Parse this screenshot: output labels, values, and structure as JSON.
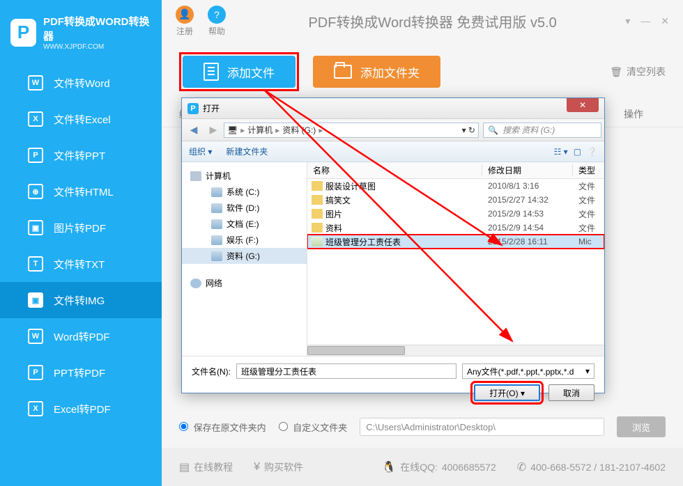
{
  "logo": {
    "letter": "P",
    "title": "PDF转换成WORD转换器",
    "sub": "WWW.XJPDF.COM"
  },
  "sidebar": {
    "items": [
      {
        "icon": "W",
        "label": "文件转Word"
      },
      {
        "icon": "X",
        "label": "文件转Excel"
      },
      {
        "icon": "P",
        "label": "文件转PPT"
      },
      {
        "icon": "⊕",
        "label": "文件转HTML"
      },
      {
        "icon": "▣",
        "label": "图片转PDF"
      },
      {
        "icon": "T",
        "label": "文件转TXT"
      },
      {
        "icon": "▣",
        "label": "文件转IMG"
      },
      {
        "icon": "W",
        "label": "Word转PDF"
      },
      {
        "icon": "P",
        "label": "PPT转PDF"
      },
      {
        "icon": "X",
        "label": "Excel转PDF"
      }
    ]
  },
  "topbar": {
    "register": "注册",
    "help": "帮助",
    "title": "PDF转换成Word转换器 免费试用版 v5.0"
  },
  "actions": {
    "add_file": "添加文件",
    "add_folder": "添加文件夹",
    "clear_list": "清空列表"
  },
  "table": {
    "col_name": "编",
    "col_ops": "操作"
  },
  "dialog": {
    "title": "打开",
    "path_parts": [
      "计算机",
      "资料 (G:)"
    ],
    "search_placeholder": "搜索 资料 (G:)",
    "organize": "组织",
    "new_folder": "新建文件夹",
    "col_name": "名称",
    "col_date": "修改日期",
    "col_type": "类型",
    "tree": [
      {
        "label": "计算机",
        "level": 0,
        "icon": "comp"
      },
      {
        "label": "系统 (C:)",
        "level": 2,
        "icon": "drive"
      },
      {
        "label": "软件 (D:)",
        "level": 2,
        "icon": "drive"
      },
      {
        "label": "文档 (E:)",
        "level": 2,
        "icon": "drive"
      },
      {
        "label": "娱乐 (F:)",
        "level": 2,
        "icon": "drive"
      },
      {
        "label": "资料 (G:)",
        "level": 2,
        "icon": "drive",
        "selected": true
      },
      {
        "label": "",
        "level": 0,
        "spacer": true
      },
      {
        "label": "网络",
        "level": 0,
        "icon": "net"
      }
    ],
    "files": [
      {
        "name": "服装设计草图",
        "date": "2010/8/1 3:16",
        "type": "文件",
        "kind": "folder"
      },
      {
        "name": "搞笑文",
        "date": "2015/2/27 14:32",
        "type": "文件",
        "kind": "folder"
      },
      {
        "name": "图片",
        "date": "2015/2/9 14:53",
        "type": "文件",
        "kind": "folder"
      },
      {
        "name": "资料",
        "date": "2015/2/9 14:54",
        "type": "文件",
        "kind": "folder"
      },
      {
        "name": "班级管理分工责任表",
        "date": "2015/2/28 16:11",
        "type": "Mic",
        "kind": "file",
        "selected": true,
        "highlight": true
      }
    ],
    "filename_label": "文件名(N):",
    "filename_value": "班级管理分工责任表",
    "filter": "Any文件(*.pdf,*.ppt,*.pptx,*.d",
    "open_btn": "打开(O)",
    "cancel_btn": "取消"
  },
  "bottom": {
    "opt1": "保存在原文件夹内",
    "opt2": "自定义文件夹",
    "path": "C:\\Users\\Administrator\\Desktop\\",
    "browse": "浏览"
  },
  "footer": {
    "tutorial": "在线教程",
    "buy": "购买软件",
    "qq_label": "在线QQ:",
    "qq": "4006685572",
    "phone": "400-668-5572 / 181-2107-4602"
  }
}
